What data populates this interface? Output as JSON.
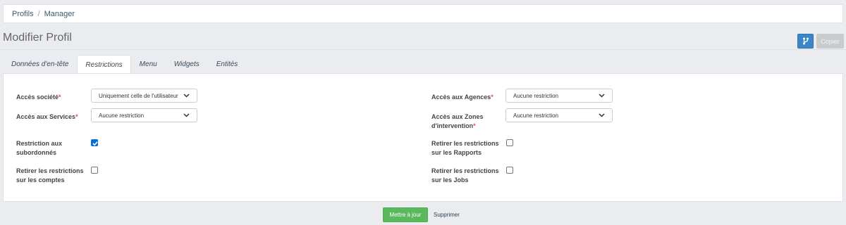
{
  "breadcrumb": {
    "items": [
      "Profils",
      "Manager"
    ],
    "separator": "/"
  },
  "page": {
    "title": "Modifier Profil"
  },
  "toolbar": {
    "branch_icon": "branch-icon",
    "copy_label": "Copier"
  },
  "tabs": [
    {
      "label": "Données d'en-tête",
      "active": false
    },
    {
      "label": "Restrictions",
      "active": true
    },
    {
      "label": "Menu",
      "active": false
    },
    {
      "label": "Widgets",
      "active": false
    },
    {
      "label": "Entités",
      "active": false
    }
  ],
  "form": {
    "required_marker": "*",
    "acces_societe": {
      "label": "Accès société",
      "value": "Uniquement celle de l'utilisateur"
    },
    "acces_services": {
      "label": "Accès aux Services",
      "value": "Aucune restriction"
    },
    "restriction_subordonnes": {
      "label_line1": "Restriction aux",
      "label_line2": "subordonnés",
      "checked": true
    },
    "retirer_comptes": {
      "label_line1": "Retirer les restrictions",
      "label_line2": "sur les comptes",
      "checked": false
    },
    "acces_agences": {
      "label": "Accès aux Agences",
      "value": "Aucune restriction"
    },
    "acces_zones": {
      "label_line1": "Accès aux Zones",
      "label_line2": "d'intervention",
      "value": "Aucune restriction"
    },
    "retirer_rapports": {
      "label_line1": "Retirer les restrictions",
      "label_line2": "sur les Rapports",
      "checked": false
    },
    "retirer_jobs": {
      "label_line1": "Retirer les restrictions",
      "label_line2": "sur les Jobs",
      "checked": false
    }
  },
  "actions": {
    "update_label": "Mettre à jour",
    "delete_label": "Supprimer"
  },
  "colors": {
    "primary": "#3b86c6",
    "success": "#5cb85c",
    "required": "#d9534f",
    "checkbox": "#0a6cd6"
  }
}
